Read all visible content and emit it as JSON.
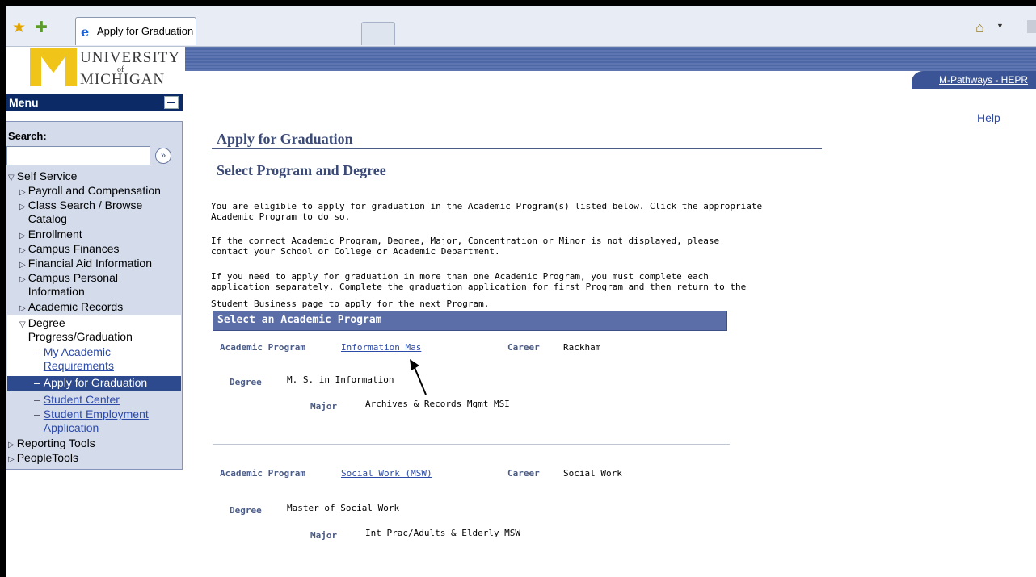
{
  "browser": {
    "tab_title": "Apply for Graduation"
  },
  "header": {
    "logo_line1": "UNIVERSITY",
    "logo_of": "of",
    "logo_line2": "MICHIGAN",
    "system_link": "M-Pathways - HEPR"
  },
  "sidebar": {
    "menu_title": "Menu",
    "search_label": "Search:",
    "search_value": "",
    "items": [
      {
        "label": "Self Service",
        "type": "expanded"
      },
      {
        "label": "Payroll and Compensation",
        "type": "collapsed"
      },
      {
        "label": "Class Search / Browse Catalog",
        "type": "collapsed"
      },
      {
        "label": "Enrollment",
        "type": "collapsed"
      },
      {
        "label": "Campus Finances",
        "type": "collapsed"
      },
      {
        "label": "Financial Aid Information",
        "type": "collapsed"
      },
      {
        "label": "Campus Personal Information",
        "type": "collapsed"
      },
      {
        "label": "Academic Records",
        "type": "collapsed"
      },
      {
        "label": "Degree Progress/Graduation",
        "type": "expanded"
      },
      {
        "label": "My Academic Requirements",
        "type": "link"
      },
      {
        "label": "Apply for Graduation",
        "type": "selected"
      },
      {
        "label": "Student Center",
        "type": "link"
      },
      {
        "label": "Student Employment Application",
        "type": "link"
      },
      {
        "label": "Reporting Tools",
        "type": "collapsed"
      },
      {
        "label": "PeopleTools",
        "type": "collapsed"
      }
    ]
  },
  "main": {
    "help_link": "Help",
    "page_title": "Apply for Graduation",
    "subtitle": "Select Program and Degree",
    "para1_line1": "You are eligible to apply for graduation in the Academic Program(s) listed below. Click the appropriate",
    "para1_line2": "Academic Program to do so.",
    "para2_line1": "If the correct Academic Program, Degree, Major, Concentration or Minor is not displayed, please",
    "para2_line2": "contact your School or College or Academic Department.",
    "para3_line1": "If you need to apply for graduation in more than one Academic Program, you must complete each",
    "para3_line2": "application separately. Complete the graduation application for first Program and then return to the",
    "para3_line3": "Student Business page to apply for the next Program.",
    "grid_header": "Select an Academic Program",
    "labels": {
      "academic_program": "Academic Program",
      "career": "Career",
      "degree": "Degree",
      "major": "Major"
    },
    "programs": [
      {
        "program": "Information Mas",
        "career": "Rackham",
        "degree": "M. S. in Information",
        "major": "Archives & Records Mgmt MSI"
      },
      {
        "program": "Social Work (MSW)",
        "career": "Social Work",
        "degree": "Master of Social Work",
        "major": "Int Prac/Adults & Elderly MSW"
      }
    ]
  },
  "icons": {
    "favorites": "star-icon",
    "add_favorites": "star-plus-icon",
    "browser": "ie-icon",
    "home": "home-icon",
    "search_go": "double-chevron-right-icon",
    "minimize": "minimize-icon"
  }
}
